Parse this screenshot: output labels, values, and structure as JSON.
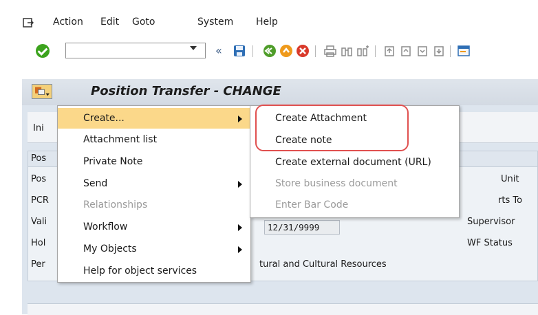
{
  "menubar": {
    "items": [
      {
        "label": "Action"
      },
      {
        "label": "Edit"
      },
      {
        "label": "Goto"
      },
      {
        "label": "System"
      },
      {
        "label": "Help"
      }
    ]
  },
  "toolbar": {
    "command_field": "",
    "prev_glyph": "«"
  },
  "title": {
    "text": "Position Transfer - CHANGE"
  },
  "tabs": {
    "first_label": "Ini"
  },
  "panel": {
    "head_label": "Pos",
    "left_labels": [
      "Pos",
      "PCR",
      "Vali",
      "Hol",
      "Per"
    ],
    "right_labels": [
      "Unit",
      "rts To",
      "Supervisor",
      "WF Status"
    ],
    "valid_to": "12/31/9999",
    "org_text": "tural and Cultural Resources"
  },
  "context_menu": {
    "items": [
      {
        "label": "Create...",
        "highlighted": true,
        "submenu": true,
        "disabled": false
      },
      {
        "label": "Attachment list",
        "highlighted": false,
        "submenu": false,
        "disabled": false
      },
      {
        "label": "Private Note",
        "highlighted": false,
        "submenu": false,
        "disabled": false
      },
      {
        "label": "Send",
        "highlighted": false,
        "submenu": true,
        "disabled": false
      },
      {
        "label": "Relationships",
        "highlighted": false,
        "submenu": false,
        "disabled": true
      },
      {
        "label": "Workflow",
        "highlighted": false,
        "submenu": true,
        "disabled": false
      },
      {
        "label": "My Objects",
        "highlighted": false,
        "submenu": true,
        "disabled": false
      },
      {
        "label": "Help for object services",
        "highlighted": false,
        "submenu": false,
        "disabled": false
      }
    ]
  },
  "sub_menu": {
    "items": [
      {
        "label": "Create Attachment",
        "disabled": false
      },
      {
        "label": "Create note",
        "disabled": false
      },
      {
        "label": "Create external document (URL)",
        "disabled": false
      },
      {
        "label": "Store business document",
        "disabled": true
      },
      {
        "label": "Enter Bar Code",
        "disabled": true
      }
    ]
  },
  "colors": {
    "highlight": "#fbd88a",
    "annotation": "#e0504f",
    "ok_green": "#3ca31d"
  }
}
